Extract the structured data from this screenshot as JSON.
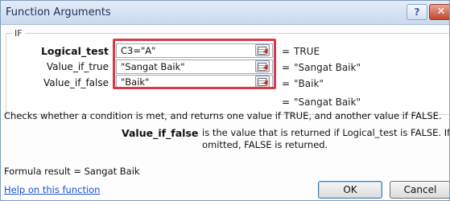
{
  "window": {
    "title": "Function Arguments",
    "help_glyph": "?",
    "close_glyph": "✕"
  },
  "function_name": "IF",
  "arguments": [
    {
      "label": "Logical_test",
      "value": "C3=\"A\"",
      "result": "TRUE"
    },
    {
      "label": "Value_if_true",
      "value": "\"Sangat Baik\"",
      "result": "\"Sangat Baik\""
    },
    {
      "label": "Value_if_false",
      "value": "\"Baik\"",
      "result": "\"Baik\""
    }
  ],
  "equals_sign": "=",
  "overall_result": "\"Sangat Baik\"",
  "description": "Checks whether a condition is met, and returns one value if TRUE, and another value if FALSE.",
  "current_arg": {
    "name": "Value_if_false",
    "description": "is the value that is returned if Logical_test is FALSE. If omitted, FALSE is returned."
  },
  "formula_result": "Formula result =  Sangat Baik",
  "help_link": "Help on this function",
  "buttons": {
    "ok": "OK",
    "cancel": "Cancel"
  },
  "colors": {
    "highlight": "#d93a48",
    "link": "#1b4fd6"
  }
}
